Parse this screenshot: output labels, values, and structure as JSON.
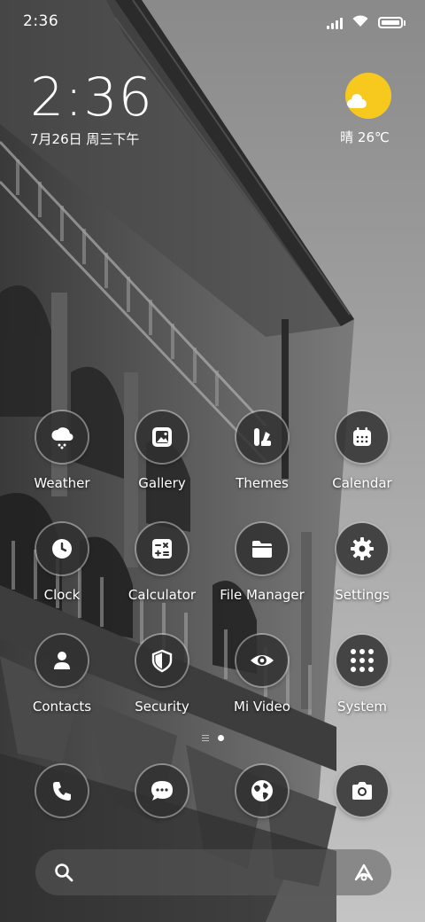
{
  "status_bar": {
    "time": "2:36",
    "icons": [
      "signal-icon",
      "wifi-icon",
      "battery-icon"
    ]
  },
  "clock_widget": {
    "time": "2:36",
    "date": "7月26日 周三下午"
  },
  "weather_widget": {
    "icon": "sun-cloud-icon",
    "text": "晴 26℃"
  },
  "apps": [
    {
      "label": "Weather",
      "icon": "weather-icon"
    },
    {
      "label": "Gallery",
      "icon": "gallery-icon"
    },
    {
      "label": "Themes",
      "icon": "themes-icon"
    },
    {
      "label": "Calendar",
      "icon": "calendar-icon"
    },
    {
      "label": "Clock",
      "icon": "clock-icon"
    },
    {
      "label": "Calculator",
      "icon": "calculator-icon"
    },
    {
      "label": "File Manager",
      "icon": "folder-icon"
    },
    {
      "label": "Settings",
      "icon": "gear-icon"
    },
    {
      "label": "Contacts",
      "icon": "contacts-icon"
    },
    {
      "label": "Security",
      "icon": "shield-icon"
    },
    {
      "label": "Mi Video",
      "icon": "eye-icon"
    },
    {
      "label": "System",
      "icon": "app-folder-icon"
    }
  ],
  "dock": [
    {
      "icon": "phone-icon"
    },
    {
      "icon": "message-icon"
    },
    {
      "icon": "browser-icon"
    },
    {
      "icon": "camera-icon"
    }
  ],
  "page_indicator": {
    "pages": 1,
    "current": 1
  },
  "search_bar": {
    "left_icon": "search-icon",
    "right_icon": "assistant-icon"
  },
  "colors": {
    "sun": "#f7c81e",
    "icon_bg": "#303030"
  }
}
